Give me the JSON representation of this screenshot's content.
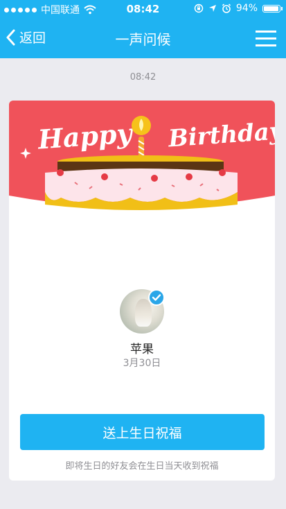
{
  "status_bar": {
    "carrier": "中国联通",
    "time": "08:42",
    "battery": "94%",
    "battery_level": 0.94
  },
  "nav": {
    "back_label": "返回",
    "title": "一声问候"
  },
  "message_time": "08:42",
  "card": {
    "banner_text_left": "Happy",
    "banner_text_right": "Birthday",
    "friend_name": "苹果",
    "birthday_date": "3月30日",
    "send_button": "送上生日祝福",
    "note": "即将生日的好友会在生日当天收到祝福"
  },
  "colors": {
    "brand_blue": "#1fb3f2",
    "banner_red": "#f0525a",
    "cake_yellow": "#f1bf17",
    "cake_brown": "#5b3514"
  }
}
